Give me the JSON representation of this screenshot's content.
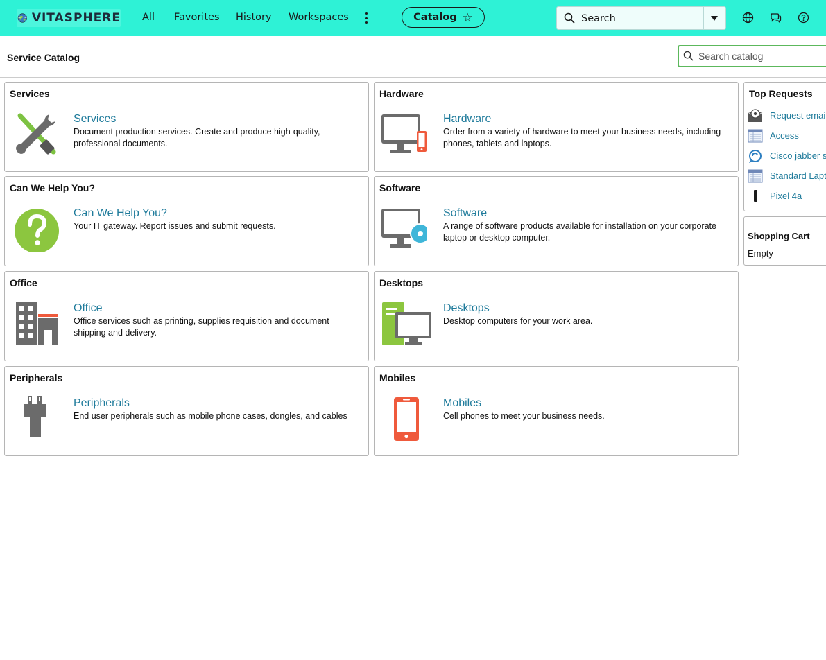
{
  "nav": {
    "logo_text": "VITASPHERE",
    "links": [
      "All",
      "Favorites",
      "History",
      "Workspaces"
    ],
    "catalog_label": "Catalog",
    "search_label": "Search"
  },
  "header": {
    "title": "Service Catalog",
    "search_placeholder": "Search catalog"
  },
  "cards": [
    {
      "title": "Services",
      "link": "Services",
      "desc": "Document production services. Create and produce high-quality, professional documents.",
      "icon": "wrench-screwdriver-icon"
    },
    {
      "title": "Hardware",
      "link": "Hardware",
      "desc": "Order from a variety of hardware to meet your business needs, including phones, tablets and laptops.",
      "icon": "monitor-phone-icon"
    },
    {
      "title": "Can We Help You?",
      "link": "Can We Help You?",
      "desc": "Your IT gateway. Report issues and submit requests.",
      "icon": "question-icon"
    },
    {
      "title": "Software",
      "link": "Software",
      "desc": "A range of software products available for installation on your corporate laptop or desktop computer.",
      "icon": "monitor-disc-icon"
    },
    {
      "title": "Office",
      "link": "Office",
      "desc": "Office services such as printing, supplies requisition and document shipping and delivery.",
      "icon": "office-building-icon"
    },
    {
      "title": "Desktops",
      "link": "Desktops",
      "desc": "Desktop computers for your work area.",
      "icon": "desktop-tower-icon"
    },
    {
      "title": "Peripherals",
      "link": "Peripherals",
      "desc": "End user peripherals such as mobile phone cases, dongles, and cables",
      "icon": "plug-icon"
    },
    {
      "title": "Mobiles",
      "link": "Mobiles",
      "desc": "Cell phones to meet your business needs.",
      "icon": "mobile-phone-icon"
    }
  ],
  "top_requests": {
    "title": "Top Requests",
    "items": [
      {
        "label": "Request emai",
        "icon": "email-request-icon"
      },
      {
        "label": "Access",
        "icon": "form-icon"
      },
      {
        "label": "Cisco jabber s",
        "icon": "jabber-icon"
      },
      {
        "label": "Standard Lapt",
        "icon": "form-icon"
      },
      {
        "label": "Pixel 4a",
        "icon": "phone-icon"
      }
    ]
  },
  "cart": {
    "title": "Shopping Cart",
    "status": "Empty"
  },
  "colors": {
    "nav_bg": "#2ef2d6",
    "link": "#1f7b9b",
    "search_focus": "#5cb85c"
  }
}
